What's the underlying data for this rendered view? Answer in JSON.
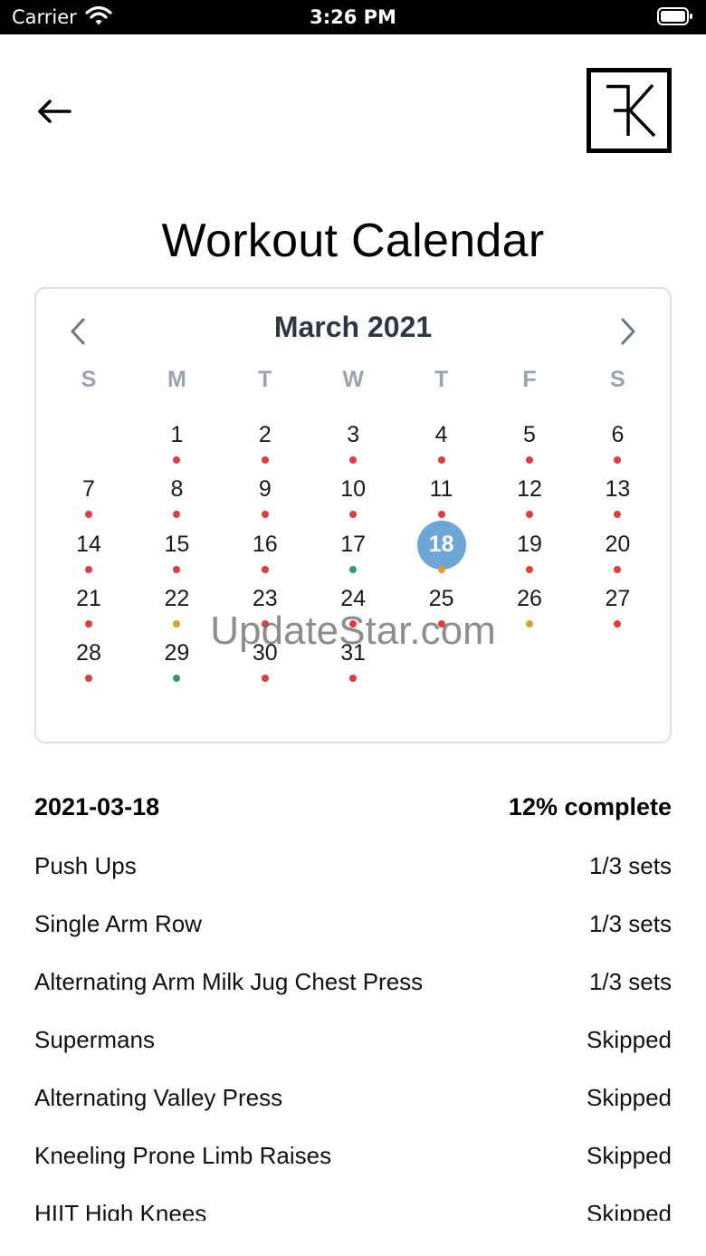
{
  "status_bar": {
    "carrier": "Carrier",
    "time": "3:26 PM"
  },
  "header": {
    "back_icon": "arrow-left-icon",
    "logo_icon": "fk-logo"
  },
  "title": "Workout Calendar",
  "calendar": {
    "month_label": "March 2021",
    "weekdays": [
      "S",
      "M",
      "T",
      "W",
      "T",
      "F",
      "S"
    ],
    "first_weekday_index": 1,
    "selected_day": 18,
    "dot_colors": {
      "red": "#e03c3c",
      "green": "#2f9e64",
      "orange": "#d9a031"
    },
    "selected_color": "#6fa6d8",
    "days": [
      {
        "day": "1",
        "status": "red"
      },
      {
        "day": "2",
        "status": "red"
      },
      {
        "day": "3",
        "status": "red"
      },
      {
        "day": "4",
        "status": "red"
      },
      {
        "day": "5",
        "status": "red"
      },
      {
        "day": "6",
        "status": "red"
      },
      {
        "day": "7",
        "status": "red"
      },
      {
        "day": "8",
        "status": "red"
      },
      {
        "day": "9",
        "status": "red"
      },
      {
        "day": "10",
        "status": "red"
      },
      {
        "day": "11",
        "status": "red"
      },
      {
        "day": "12",
        "status": "red"
      },
      {
        "day": "13",
        "status": "red"
      },
      {
        "day": "14",
        "status": "red"
      },
      {
        "day": "15",
        "status": "red"
      },
      {
        "day": "16",
        "status": "red"
      },
      {
        "day": "17",
        "status": "green"
      },
      {
        "day": "18",
        "status": "orange"
      },
      {
        "day": "19",
        "status": "red"
      },
      {
        "day": "20",
        "status": "red"
      },
      {
        "day": "21",
        "status": "red"
      },
      {
        "day": "22",
        "status": "orange"
      },
      {
        "day": "23",
        "status": "red"
      },
      {
        "day": "24",
        "status": "red"
      },
      {
        "day": "25",
        "status": "red"
      },
      {
        "day": "26",
        "status": "orange"
      },
      {
        "day": "27",
        "status": "red"
      },
      {
        "day": "28",
        "status": "red"
      },
      {
        "day": "29",
        "status": "green"
      },
      {
        "day": "30",
        "status": "red"
      },
      {
        "day": "31",
        "status": "red"
      }
    ]
  },
  "watermark": "UpdateStar.com",
  "summary": {
    "date": "2021-03-18",
    "progress": "12% complete"
  },
  "exercises": [
    {
      "name": "Push Ups",
      "status": "1/3 sets"
    },
    {
      "name": "Single Arm Row",
      "status": "1/3 sets"
    },
    {
      "name": "Alternating Arm Milk Jug Chest Press",
      "status": "1/3 sets"
    },
    {
      "name": "Supermans",
      "status": "Skipped"
    },
    {
      "name": "Alternating Valley Press",
      "status": "Skipped"
    },
    {
      "name": "Kneeling Prone Limb Raises",
      "status": "Skipped"
    },
    {
      "name": "HIIT High Knees",
      "status": "Skipped"
    }
  ]
}
